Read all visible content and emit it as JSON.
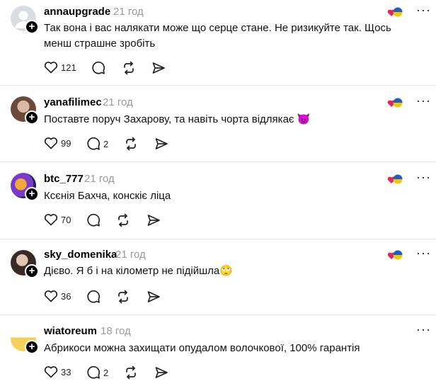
{
  "colors": {
    "text": "#000000",
    "muted": "#999999",
    "divider": "#e5e5e5",
    "heart": "#e0245e",
    "flag_blue": "#1f5fbf",
    "flag_yellow": "#f6c400"
  },
  "icons": {
    "like": "heart-icon",
    "reply": "comment-icon",
    "repost": "repost-icon",
    "share": "send-icon",
    "follow": "plus-icon",
    "more": "more-icon",
    "badge": "heart-flag-icon"
  },
  "posts": [
    {
      "username": "annaupgrade",
      "time": "21 год",
      "text": "Так вона і вас налякати може що серце стане. Не ризикуйте так. Щось менш страшне зробіть",
      "likes": "121",
      "replies": ""
    },
    {
      "username": "yanafilimec",
      "time": "21 год",
      "text": "Поставте поруч Захарову, та навіть чорта відлякає 👿",
      "likes": "99",
      "replies": "2"
    },
    {
      "username": "btc_777",
      "time": "21 год",
      "text": "Ксєнія Бахча, конскіє ліца",
      "likes": "70",
      "replies": ""
    },
    {
      "username": "sky_domenika",
      "time": "21 год",
      "text": "Дієво. Я б і на кілометр не підійшла🙄",
      "likes": "36",
      "replies": ""
    },
    {
      "username": "wiatoreum",
      "time": "18 год",
      "text": "Абрикоси можна захищати опудалом волочкової, 100% гарантія",
      "likes": "33",
      "replies": "2"
    }
  ]
}
